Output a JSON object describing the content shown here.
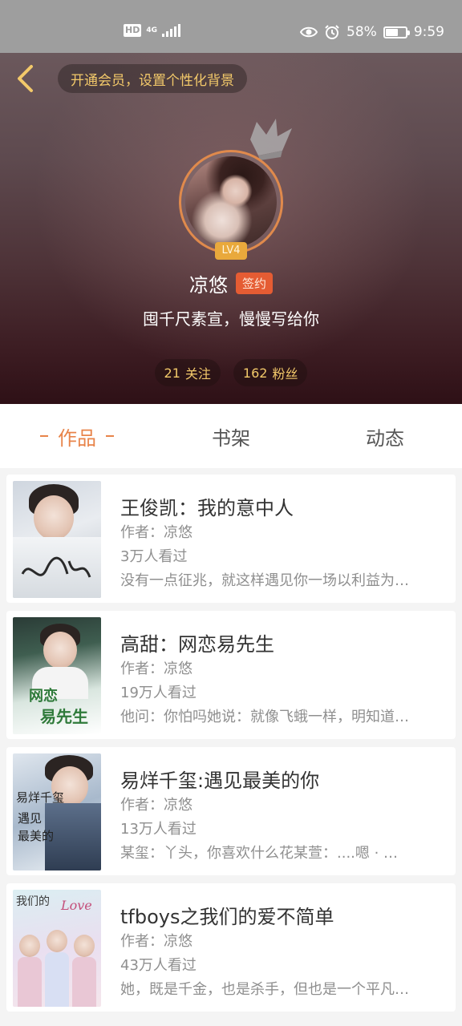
{
  "status_bar": {
    "hd": "HD",
    "network": "4G",
    "battery_percent": "58%",
    "battery_level": 0.58,
    "time": "9:59"
  },
  "header": {
    "vip_banner": "开通会员，设置个性化背景",
    "level": "LV4",
    "name": "凉悠",
    "sign_badge": "签约",
    "bio": "囤千尺素宣，慢慢写给你",
    "following_count": "21",
    "following_label": "关注",
    "fans_count": "162",
    "fans_label": "粉丝",
    "accent_color": "#f3c96a"
  },
  "tabs": [
    {
      "label": "作品",
      "active": true
    },
    {
      "label": "书架",
      "active": false
    },
    {
      "label": "动态",
      "active": false
    }
  ],
  "books": [
    {
      "title": "王俊凯：我的意中人",
      "author": "作者：凉悠",
      "views": "3万人看过",
      "desc": "没有一点征兆，就这样遇见你一场以利益为…"
    },
    {
      "title": "高甜：网恋易先生",
      "author": "作者：凉悠",
      "views": "19万人看过",
      "desc": "他问：你怕吗她说：就像飞蛾一样，明知道…"
    },
    {
      "title": "易烊千玺:遇见最美的你",
      "author": "作者：凉悠",
      "views": "13万人看过",
      "desc": "某玺：丫头，你喜欢什么花某萱：....嗯 · …"
    },
    {
      "title": "tfboys之我们的爱不简单",
      "author": "作者：凉悠",
      "views": "43万人看过",
      "desc": "她，既是千金，也是杀手，但也是一个平凡…"
    }
  ]
}
